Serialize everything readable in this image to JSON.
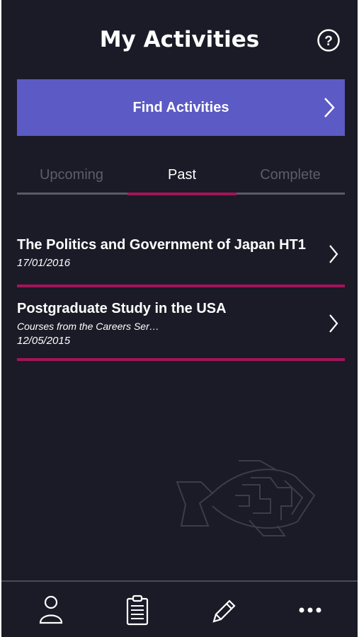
{
  "header": {
    "title": "My Activities",
    "help_icon": "help-circle-icon"
  },
  "find_button": {
    "label": "Find Activities",
    "icon": "chevron-right-icon"
  },
  "tabs": [
    {
      "label": "Upcoming",
      "active": false
    },
    {
      "label": "Past",
      "active": true
    },
    {
      "label": "Complete",
      "active": false
    }
  ],
  "activities": [
    {
      "title": "The Politics and Government of Japan HT1",
      "subtitle": "",
      "date": "17/01/2016"
    },
    {
      "title": "Postgraduate Study in the USA",
      "subtitle": "Courses from the Careers Ser…",
      "date": "12/05/2015"
    }
  ],
  "bottom_nav": [
    {
      "icon": "profile-icon"
    },
    {
      "icon": "clipboard-icon"
    },
    {
      "icon": "pencil-icon"
    },
    {
      "icon": "more-icon"
    }
  ],
  "colors": {
    "background": "#1b1b27",
    "accent": "#5c5ac4",
    "highlight": "#a3145a"
  }
}
